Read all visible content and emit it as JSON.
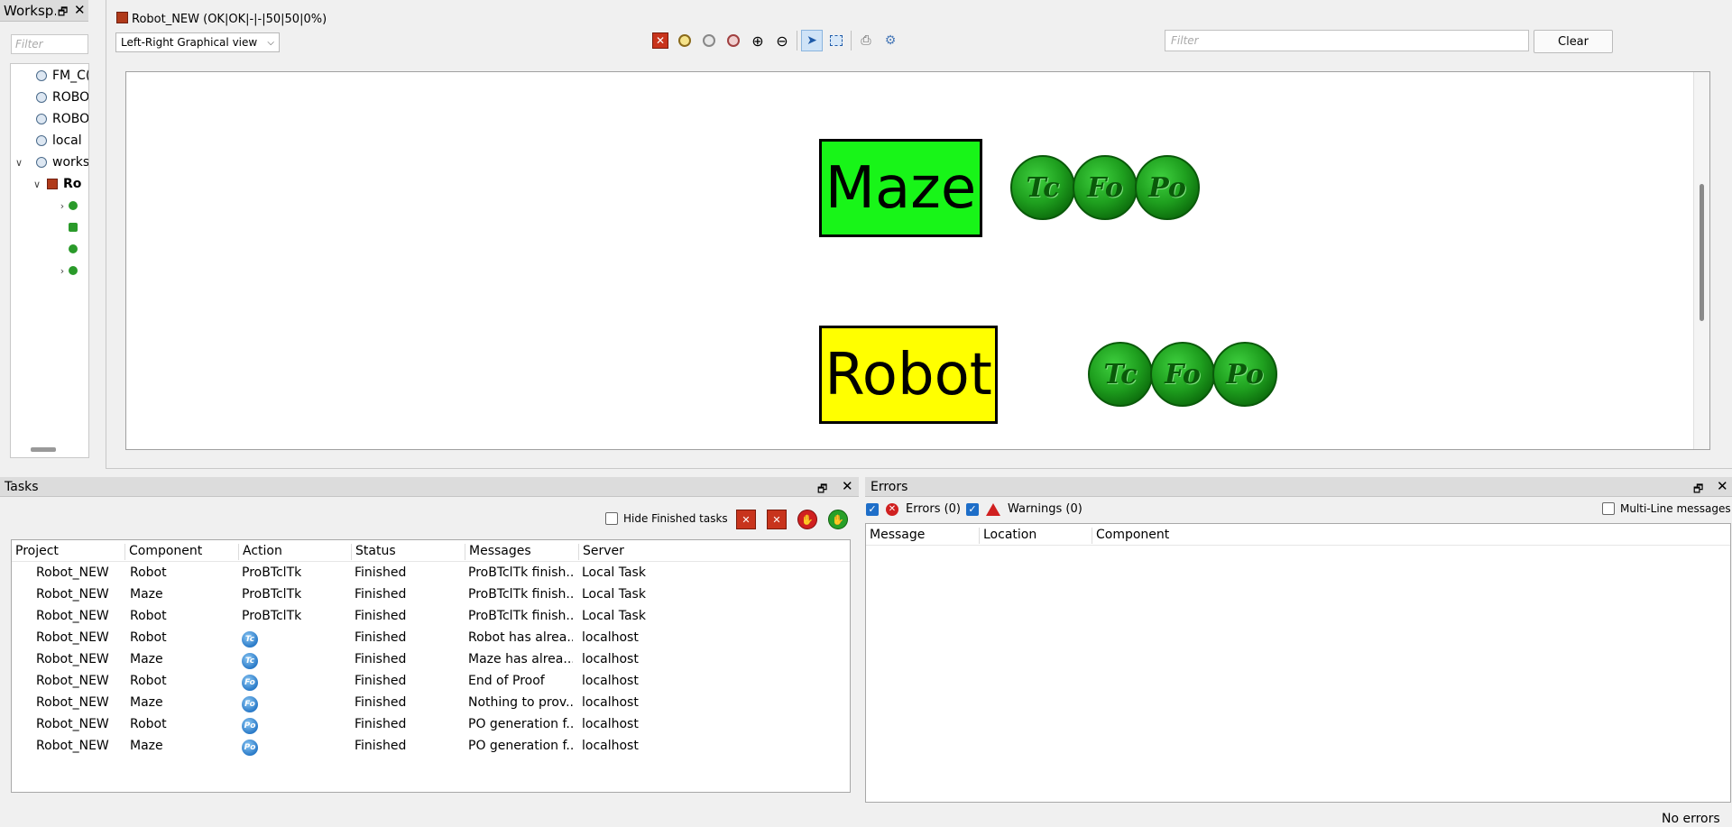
{
  "workspace": {
    "title": "Worksp...",
    "filter_placeholder": "Filter",
    "tree": [
      "FM_C(",
      "ROBO",
      "ROBO",
      "local",
      "works",
      "Ro"
    ]
  },
  "editor": {
    "tab_title": "Robot_NEW (OK|OK|-|-|50|50|0%)",
    "view_mode": "Left-Right Graphical view",
    "filter_placeholder": "Filter",
    "clear_label": "Clear",
    "components": [
      {
        "name": "Maze",
        "color": "#18f518"
      },
      {
        "name": "Robot",
        "color": "#ffff00"
      }
    ],
    "badges": [
      "Tc",
      "Fo",
      "Po"
    ]
  },
  "tasks": {
    "title": "Tasks",
    "hide_finished_label": "Hide Finished tasks",
    "columns": [
      "Project",
      "Component",
      "Action",
      "Status",
      "Messages",
      "Server"
    ],
    "rows": [
      {
        "project": "Robot_NEW",
        "component": "Robot",
        "action": "ProBTclTk",
        "action_icon": "",
        "status": "Finished",
        "message": "ProBTclTk finish...",
        "server": "Local Task"
      },
      {
        "project": "Robot_NEW",
        "component": "Maze",
        "action": "ProBTclTk",
        "action_icon": "",
        "status": "Finished",
        "message": "ProBTclTk finish...",
        "server": "Local Task"
      },
      {
        "project": "Robot_NEW",
        "component": "Robot",
        "action": "ProBTclTk",
        "action_icon": "",
        "status": "Finished",
        "message": "ProBTclTk finish...",
        "server": "Local Task"
      },
      {
        "project": "Robot_NEW",
        "component": "Robot",
        "action": "",
        "action_icon": "Tc",
        "status": "Finished",
        "message": "Robot has alrea...",
        "server": "localhost"
      },
      {
        "project": "Robot_NEW",
        "component": "Maze",
        "action": "",
        "action_icon": "Tc",
        "status": "Finished",
        "message": "Maze has alrea...",
        "server": "localhost"
      },
      {
        "project": "Robot_NEW",
        "component": "Robot",
        "action": "",
        "action_icon": "Fo",
        "status": "Finished",
        "message": "End of Proof",
        "server": "localhost"
      },
      {
        "project": "Robot_NEW",
        "component": "Maze",
        "action": "",
        "action_icon": "Fo",
        "status": "Finished",
        "message": "Nothing to prov...",
        "server": "localhost"
      },
      {
        "project": "Robot_NEW",
        "component": "Robot",
        "action": "",
        "action_icon": "Po",
        "status": "Finished",
        "message": "PO generation f...",
        "server": "localhost"
      },
      {
        "project": "Robot_NEW",
        "component": "Maze",
        "action": "",
        "action_icon": "Po",
        "status": "Finished",
        "message": "PO generation f...",
        "server": "localhost"
      }
    ]
  },
  "errors": {
    "title": "Errors",
    "errors_label": "Errors (0)",
    "warnings_label": "Warnings (0)",
    "multiline_label": "Multi-Line messages",
    "columns": [
      "Message",
      "Location",
      "Component"
    ],
    "status": "No errors"
  }
}
